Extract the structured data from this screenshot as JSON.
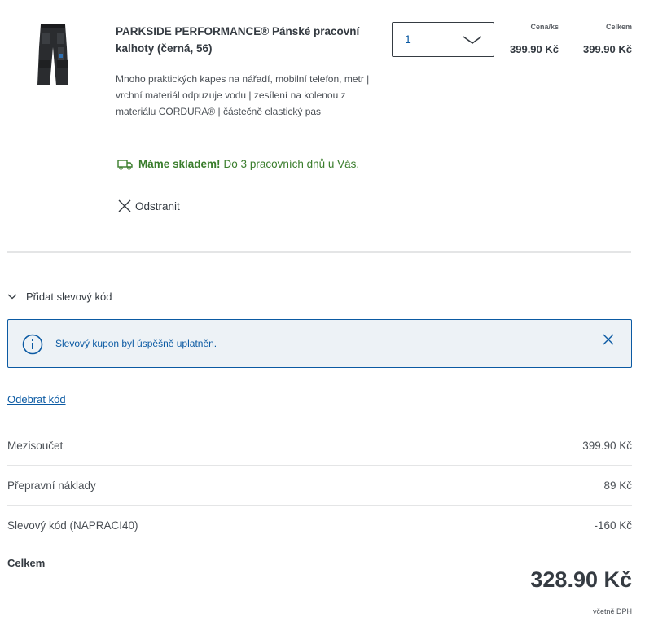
{
  "product": {
    "title": "PARKSIDE PERFORMANCE® Pánské pracovní kalhoty (černá, 56)",
    "description": "Mnoho praktických kapes na nářadí, mobilní telefon, metr | vrchní materiál odpuzuje vodu | zesílení na kolenou z materiálu CORDURA® | částečně elastický pas",
    "image_icon": "work-trousers-image",
    "quantity": "1",
    "unit_price_label": "Cena/ks",
    "unit_price": "399.90 Kč",
    "total_label": "Celkem",
    "total_price": "399.90 Kč",
    "stock_bold": "Máme skladem!",
    "stock_text": "Do 3 pracovních dnů u Vás.",
    "remove_label": "Odstranit"
  },
  "discount": {
    "toggle_label": "Přidat slevový kód",
    "alert_text": "Slevový kupon byl úspěšně uplatněn.",
    "remove_code_label": "Odebrat kód"
  },
  "summary": {
    "rows": [
      {
        "label": "Mezisoučet",
        "value": "399.90 Kč"
      },
      {
        "label": "Přepravní náklady",
        "value": "89 Kč"
      },
      {
        "label": "Slevový kód (NAPRACI40)",
        "value": "-160 Kč"
      }
    ],
    "grand_label": "Celkem",
    "grand_value": "328.90 Kč",
    "vat_note": "včetně DPH"
  },
  "colors": {
    "text": "#353b42",
    "link_blue": "#0b5aa3",
    "stock_green": "#3a7d2c",
    "alert_bg": "#edf2f6",
    "divider": "#e4e5e6"
  }
}
